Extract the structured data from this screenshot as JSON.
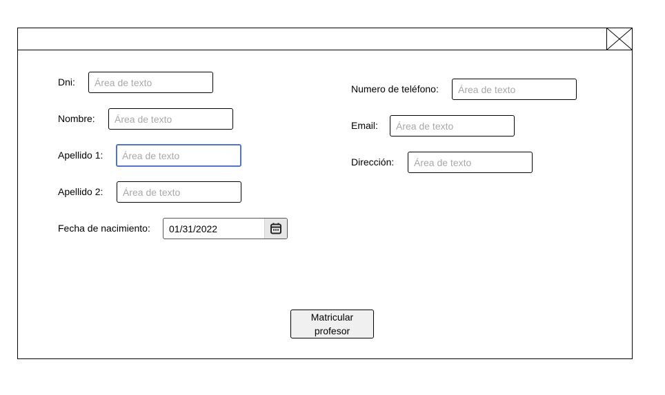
{
  "form": {
    "left": {
      "dni": {
        "label": "Dni:",
        "placeholder": "Área de texto"
      },
      "nombre": {
        "label": "Nombre:",
        "placeholder": "Área de texto"
      },
      "apellido1": {
        "label": "Apellido 1:",
        "placeholder": "Área de texto"
      },
      "apellido2": {
        "label": "Apellido 2:",
        "placeholder": "Área de texto"
      },
      "fecha": {
        "label": "Fecha de nacimiento:",
        "value": "01/31/2022"
      }
    },
    "right": {
      "telefono": {
        "label": "Numero de teléfono:",
        "placeholder": "Área de texto"
      },
      "email": {
        "label": "Email:",
        "placeholder": "Área de texto"
      },
      "direccion": {
        "label": "Dirección:",
        "placeholder": "Área de texto"
      }
    }
  },
  "submit": {
    "line1": "Matricular",
    "line2": "profesor"
  },
  "icons": {
    "close": "close-icon",
    "calendar": "calendar-icon"
  },
  "colors": {
    "focus_border": "#4e73c9",
    "placeholder": "#a8a8a8",
    "button_bg": "#f0f0f0"
  }
}
